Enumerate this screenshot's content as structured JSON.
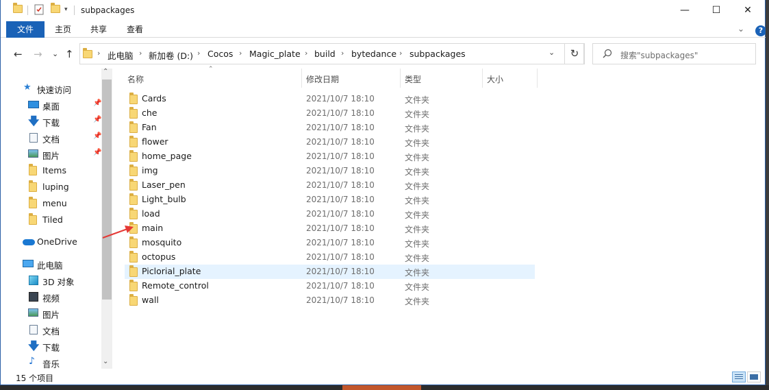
{
  "window": {
    "title": "subpackages",
    "controls": {
      "minimize": "—",
      "maximize": "☐",
      "close": "✕"
    }
  },
  "ribbon": {
    "tabs": [
      "文件",
      "主页",
      "共享",
      "查看"
    ],
    "collapse": "⌄",
    "help": "?"
  },
  "address": {
    "back": "←",
    "forward": "→",
    "recent": "⌄",
    "up": "↑",
    "breadcrumbs": [
      "此电脑",
      "新加卷 (D:)",
      "Cocos",
      "Magic_plate",
      "build",
      "bytedance",
      "subpackages"
    ],
    "dropdown": "⌄",
    "refresh": "↻"
  },
  "search": {
    "placeholder": "搜索\"subpackages\"",
    "icon": "search-icon"
  },
  "nav": {
    "quick_access": "快速访问",
    "pinned": [
      {
        "label": "桌面",
        "icon": "desktop-icon"
      },
      {
        "label": "下载",
        "icon": "download-icon"
      },
      {
        "label": "文档",
        "icon": "document-icon"
      },
      {
        "label": "图片",
        "icon": "picture-icon"
      }
    ],
    "folders": [
      "Items",
      "luping",
      "menu",
      "Tiled"
    ],
    "onedrive": "OneDrive",
    "this_pc": "此电脑",
    "pc_items": [
      {
        "label": "3D 对象",
        "icon": "3d-objects-icon"
      },
      {
        "label": "视频",
        "icon": "video-icon"
      },
      {
        "label": "图片",
        "icon": "picture-icon"
      },
      {
        "label": "文档",
        "icon": "document-icon"
      },
      {
        "label": "下载",
        "icon": "download-icon"
      },
      {
        "label": "音乐",
        "icon": "music-icon"
      }
    ],
    "scroll_up": "⌃",
    "scroll_down": "⌄"
  },
  "columns": {
    "name": "名称",
    "date": "修改日期",
    "type": "类型",
    "size": "大小",
    "sort_indicator": "⌃"
  },
  "files": [
    {
      "name": "Cards",
      "date": "2021/10/7 18:10",
      "type": "文件夹"
    },
    {
      "name": "che",
      "date": "2021/10/7 18:10",
      "type": "文件夹"
    },
    {
      "name": "Fan",
      "date": "2021/10/7 18:10",
      "type": "文件夹"
    },
    {
      "name": "flower",
      "date": "2021/10/7 18:10",
      "type": "文件夹"
    },
    {
      "name": "home_page",
      "date": "2021/10/7 18:10",
      "type": "文件夹"
    },
    {
      "name": "img",
      "date": "2021/10/7 18:10",
      "type": "文件夹"
    },
    {
      "name": "Laser_pen",
      "date": "2021/10/7 18:10",
      "type": "文件夹"
    },
    {
      "name": "Light_bulb",
      "date": "2021/10/7 18:10",
      "type": "文件夹"
    },
    {
      "name": "load",
      "date": "2021/10/7 18:10",
      "type": "文件夹"
    },
    {
      "name": "main",
      "date": "2021/10/7 18:10",
      "type": "文件夹"
    },
    {
      "name": "mosquito",
      "date": "2021/10/7 18:10",
      "type": "文件夹"
    },
    {
      "name": "octopus",
      "date": "2021/10/7 18:10",
      "type": "文件夹"
    },
    {
      "name": "Piclorial_plate",
      "date": "2021/10/7 18:10",
      "type": "文件夹"
    },
    {
      "name": "Remote_control",
      "date": "2021/10/7 18:10",
      "type": "文件夹"
    },
    {
      "name": "wall",
      "date": "2021/10/7 18:10",
      "type": "文件夹"
    }
  ],
  "selected_index": 12,
  "status": {
    "count": "15 个项目"
  },
  "colors": {
    "accent": "#1a62b7",
    "folder": "#f8d775",
    "selection": "#e5f3ff",
    "annotation_arrow": "#e53935"
  }
}
